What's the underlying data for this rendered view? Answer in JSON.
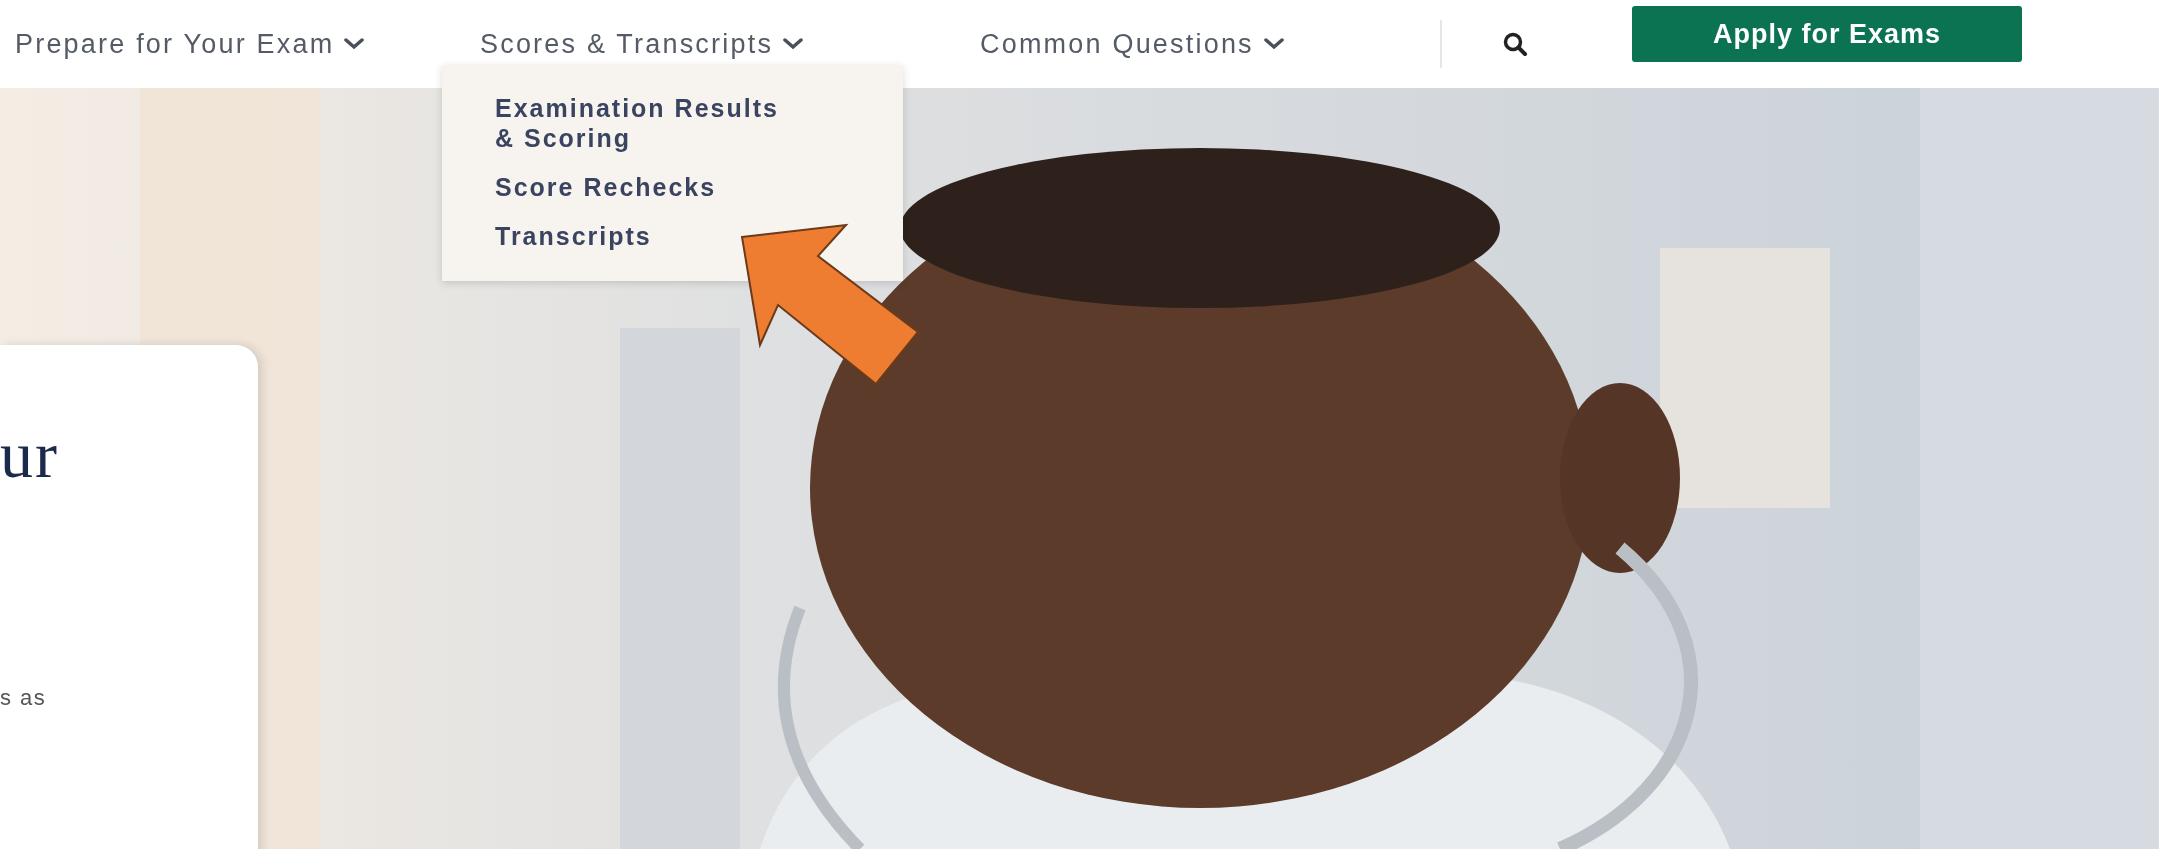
{
  "nav": {
    "items": [
      {
        "label": "Prepare for Your Exam"
      },
      {
        "label": "Scores & Transcripts",
        "children": [
          {
            "label": "Examination Results & Scoring"
          },
          {
            "label": "Score Rechecks"
          },
          {
            "label": "Transcripts"
          }
        ]
      },
      {
        "label": "Common Questions"
      }
    ],
    "cta": {
      "label": "Apply for Exams"
    }
  },
  "hero": {
    "heading": "ur",
    "text": "s as"
  }
}
